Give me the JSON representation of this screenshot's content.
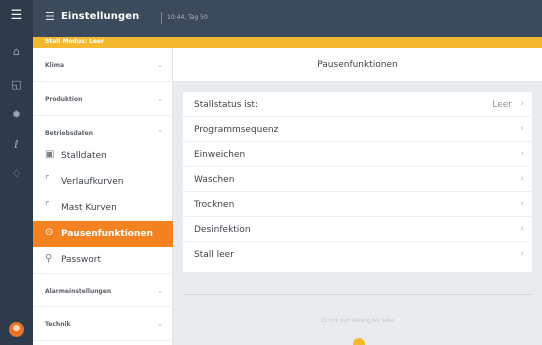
{
  "header": {
    "title": "Einstellungen",
    "time": "10:44, Tag 50",
    "settings_icon": "sliders-icon"
  },
  "banner": {
    "text": "Stall Modus: Leer"
  },
  "rail": {
    "icons": [
      "menu-icon",
      "house-icon",
      "chart-icon",
      "fan-icon",
      "thermometer-icon",
      "bell-icon",
      "avatar"
    ]
  },
  "sidebar": {
    "sections": [
      {
        "label": "Klima"
      },
      {
        "label": "Produktion"
      },
      {
        "label": "Betriebsdaten"
      },
      {
        "label": "Alarmeinstellungen"
      },
      {
        "label": "Technik"
      }
    ],
    "items": [
      {
        "label": "Stalldaten",
        "icon": "building-icon"
      },
      {
        "label": "Verlaufkurven",
        "icon": "line-chart-icon"
      },
      {
        "label": "Mast Kurven",
        "icon": "line-chart-icon"
      },
      {
        "label": "Pausenfunktionen",
        "icon": "pause-icon",
        "active": true
      },
      {
        "label": "Passwort",
        "icon": "lock-icon"
      }
    ]
  },
  "main": {
    "title": "Pausenfunktionen",
    "rows": [
      {
        "label": "Stallstatus ist:",
        "value": "Leer"
      },
      {
        "label": "Programmsequenz",
        "value": ""
      },
      {
        "label": "Einweichen",
        "value": ""
      },
      {
        "label": "Waschen",
        "value": ""
      },
      {
        "label": "Trocknen",
        "value": ""
      },
      {
        "label": "Desinfektion",
        "value": ""
      },
      {
        "label": "Stall leer",
        "value": ""
      }
    ],
    "footer_text": "Zurück zum Anfang der Seite"
  },
  "colors": {
    "rail": "#2e3b4a",
    "header": "#3b4b5c",
    "banner": "#f5b82e",
    "accent": "#f58220"
  }
}
